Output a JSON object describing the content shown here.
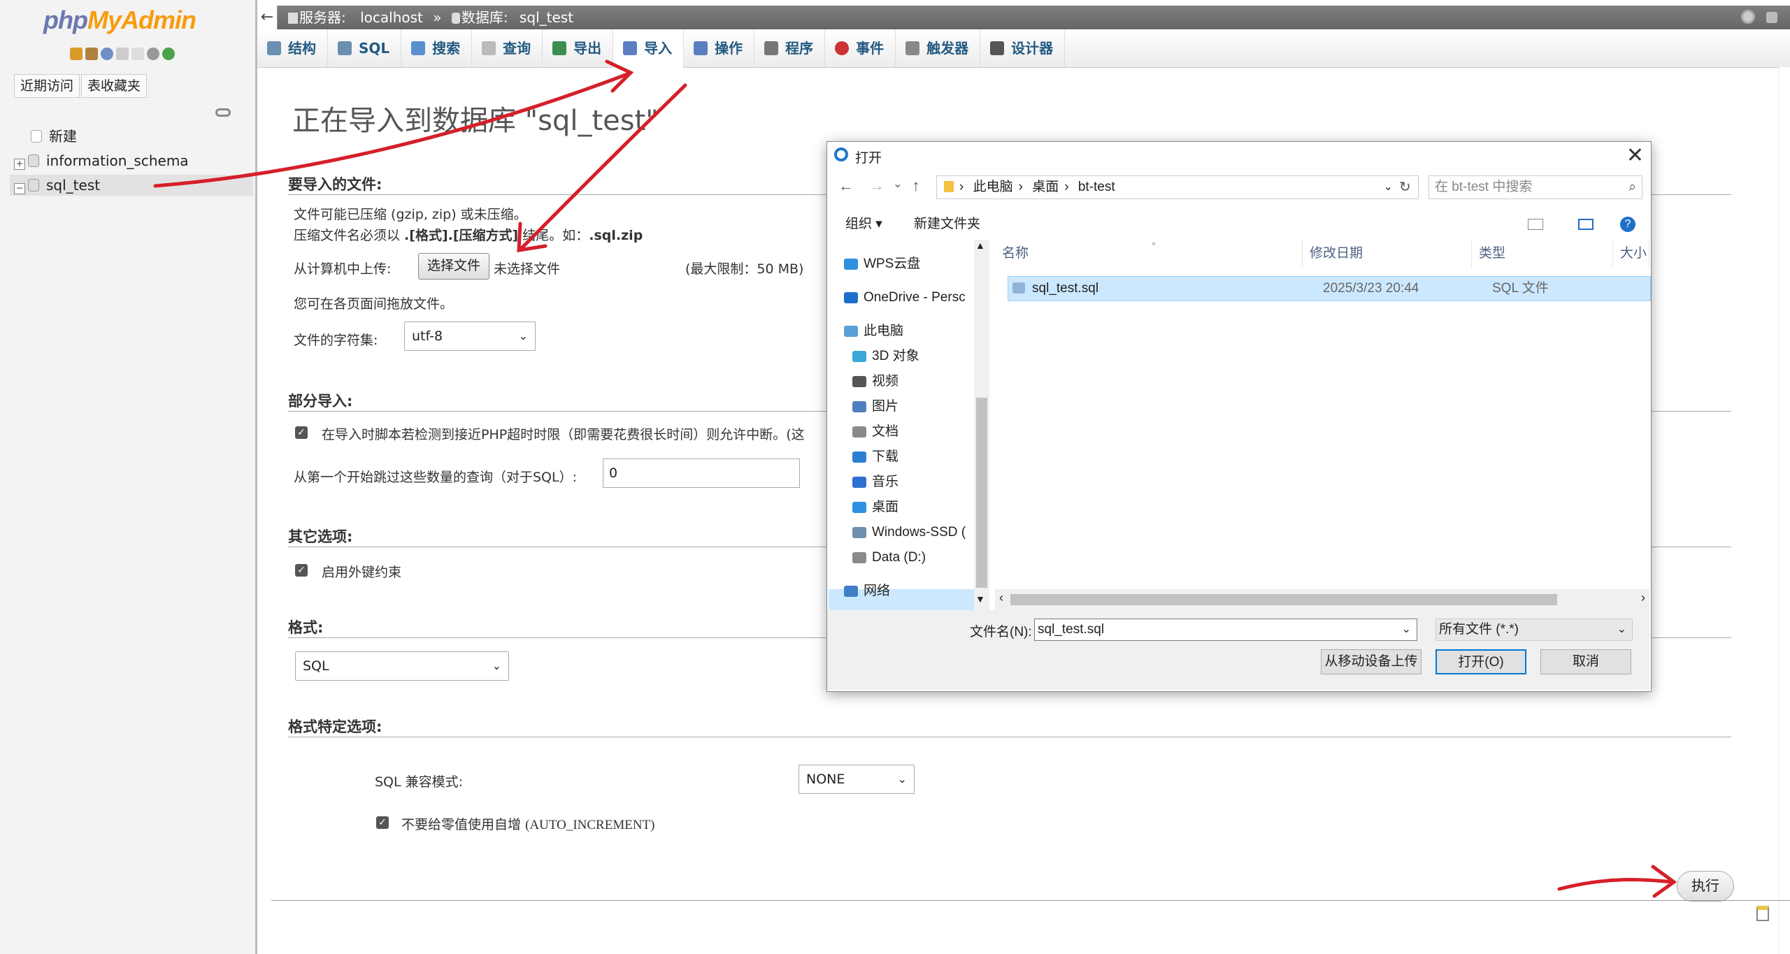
{
  "sidebar": {
    "logo_php": "php",
    "logo_my": "MyAdmin",
    "tab_recent": "近期访问",
    "tab_favorites": "表收藏夹",
    "tree": [
      {
        "label": "新建",
        "expander": ""
      },
      {
        "label": "information_schema",
        "expander": "+"
      },
      {
        "label": "sql_test",
        "expander": "−"
      }
    ]
  },
  "breadcrumb": {
    "back": "←",
    "server_label": "服务器:",
    "server_value": "localhost",
    "sep": "»",
    "db_label": "数据库:",
    "db_value": "sql_test"
  },
  "tabs": [
    {
      "label": "结构",
      "color": "#6a8fb0"
    },
    {
      "label": "SQL",
      "color": "#6a8fb0"
    },
    {
      "label": "搜索",
      "color": "#5a8fcf"
    },
    {
      "label": "查询",
      "color": "#bbbbbb"
    },
    {
      "label": "导出",
      "color": "#3d8f4f"
    },
    {
      "label": "导入",
      "color": "#5d7fc2"
    },
    {
      "label": "操作",
      "color": "#5a7fbf"
    },
    {
      "label": "程序",
      "color": "#777777"
    },
    {
      "label": "事件",
      "color": "#cc3333"
    },
    {
      "label": "触发器",
      "color": "#888888"
    },
    {
      "label": "设计器",
      "color": "#555555"
    }
  ],
  "main": {
    "title": "正在导入到数据库 \"sql_test\"",
    "file_section": {
      "heading": "要导入的文件:",
      "line1": "文件可能已压缩 (gzip, zip) 或未压缩。",
      "line2_pre": "压缩文件名必须以 ",
      "line2_bold": ".[格式].[压缩方式]",
      "line2_mid": " 结尾。如：",
      "line2_example": ".sql.zip",
      "upload_label": "从计算机中上传:",
      "choose_button": "选择文件",
      "no_file": "未选择文件",
      "max_limit": "(最大限制：50 MB)",
      "drag_hint": "您可在各页面间拖放文件。",
      "charset_label": "文件的字符集:",
      "charset_value": "utf-8"
    },
    "partial_section": {
      "heading": "部分导入:",
      "allow_interrupt": "在导入时脚本若检测到接近PHP超时时限（即需要花费很长时间）则允许中断。(这",
      "skip_label": "从第一个开始跳过这些数量的查询（对于SQL）:",
      "skip_value": "0"
    },
    "other_section": {
      "heading": "其它选项:",
      "fk_label": "启用外键约束"
    },
    "format_section": {
      "heading": "格式:",
      "format_value": "SQL"
    },
    "format_options_section": {
      "heading": "格式特定选项:",
      "compat_label": "SQL 兼容模式:",
      "compat_value": "NONE",
      "auto_inc_label": "不要给零值使用自增",
      "auto_inc_code": "(AUTO_INCREMENT)"
    },
    "go_button": "执行"
  },
  "dialog": {
    "title": "打开",
    "close": "✕",
    "nav_back": "←",
    "nav_forward": "→",
    "nav_recent": "⌄",
    "nav_up": "↑",
    "path": [
      "此电脑",
      "桌面",
      "bt-test"
    ],
    "path_sep": "›",
    "search_placeholder": "在 bt-test 中搜索",
    "organize": "组织 ▾",
    "new_folder": "新建文件夹",
    "left_items": [
      {
        "label": "WPS云盘",
        "icon": "cloud-icon",
        "color": "#2f8fe0",
        "indent": 0
      },
      {
        "label": "OneDrive - Persc",
        "icon": "cloud-icon",
        "color": "#1f6fc8",
        "indent": 0
      },
      {
        "label": "此电脑",
        "icon": "computer-icon",
        "color": "#5a9fd6",
        "indent": 0
      },
      {
        "label": "3D 对象",
        "icon": "cube-icon",
        "color": "#39a7d9",
        "indent": 1
      },
      {
        "label": "视频",
        "icon": "video-icon",
        "color": "#555555",
        "indent": 1
      },
      {
        "label": "图片",
        "icon": "picture-icon",
        "color": "#4f7fbf",
        "indent": 1
      },
      {
        "label": "文档",
        "icon": "document-icon",
        "color": "#8a8a8a",
        "indent": 1
      },
      {
        "label": "下载",
        "icon": "download-icon",
        "color": "#2f7fd0",
        "indent": 1
      },
      {
        "label": "音乐",
        "icon": "music-icon",
        "color": "#2f6fd0",
        "indent": 1
      },
      {
        "label": "桌面",
        "icon": "desktop-icon",
        "color": "#2f8fe0",
        "indent": 1
      },
      {
        "label": "Windows-SSD (",
        "icon": "drive-icon",
        "color": "#6f8faf",
        "indent": 1
      },
      {
        "label": "Data (D:)",
        "icon": "drive-icon",
        "color": "#8a8a8a",
        "indent": 1
      },
      {
        "label": "网络",
        "icon": "network-icon",
        "color": "#3f7fc8",
        "indent": 0
      }
    ],
    "columns": [
      "名称",
      "修改日期",
      "类型",
      "大小"
    ],
    "files": [
      {
        "name": "sql_test.sql",
        "modified": "2025/3/23 20:44",
        "type": "SQL 文件"
      }
    ],
    "filename_label": "文件名(N):",
    "filename_value": "sql_test.sql",
    "filter_value": "所有文件 (*.*)",
    "mobile_upload": "从移动设备上传",
    "open_button": "打开(O)",
    "cancel_button": "取消"
  }
}
